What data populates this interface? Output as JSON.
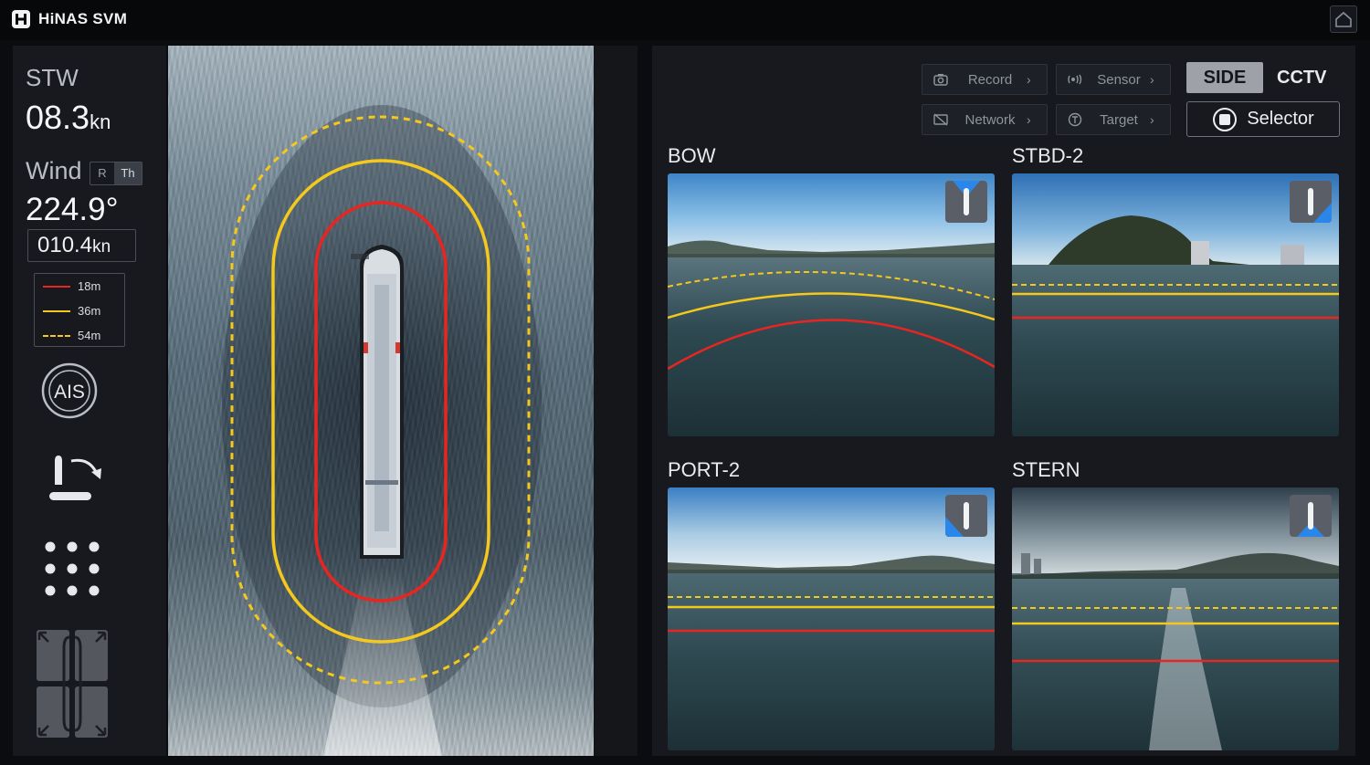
{
  "app": {
    "title": "HiNAS SVM"
  },
  "stw": {
    "label": "STW",
    "value": "08.3",
    "unit": "kn"
  },
  "wind": {
    "label": "Wind",
    "toggle": [
      "R",
      "Th"
    ],
    "direction": "224.9°",
    "speed_value": "010.4",
    "speed_unit": "kn"
  },
  "legend": [
    {
      "label": "18m",
      "color": "#e8261f",
      "style": "solid"
    },
    {
      "label": "36m",
      "color": "#f4c81c",
      "style": "solid"
    },
    {
      "label": "54m",
      "color": "#f4c81c",
      "style": "dashed"
    }
  ],
  "ais": {
    "label": "AIS"
  },
  "toolbar": {
    "record": "Record",
    "sensor": "Sensor",
    "network": "Network",
    "target": "Target"
  },
  "mode": {
    "side": "SIDE",
    "cctv": "CCTV"
  },
  "selector": {
    "label": "Selector"
  },
  "cameras": {
    "bow": "BOW",
    "stbd": "STBD-2",
    "port": "PORT-2",
    "stern": "STERN"
  },
  "colors": {
    "red_zone": "#e8261f",
    "yellow_zone": "#f4c81c",
    "accent_blue": "#2a86e8"
  }
}
